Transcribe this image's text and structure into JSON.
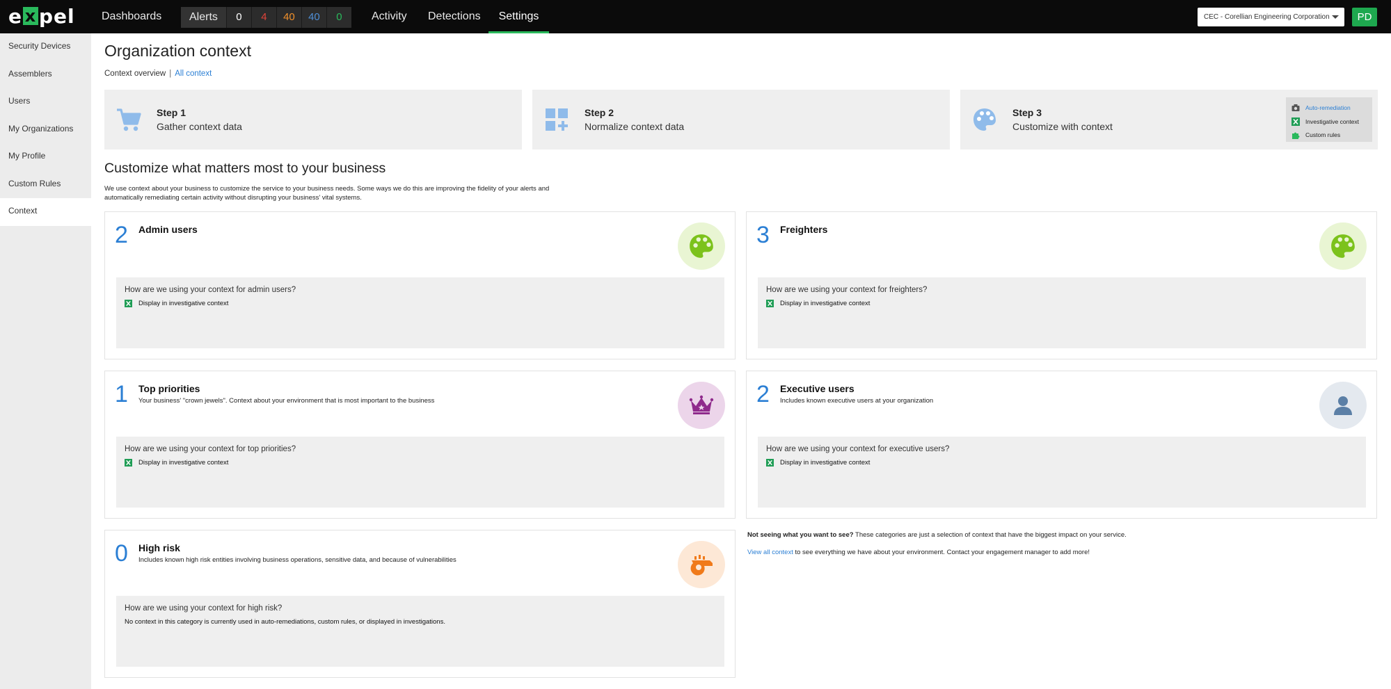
{
  "header": {
    "logo": {
      "before": "e",
      "x": "x",
      "after": "pel"
    },
    "nav": {
      "dashboards": "Dashboards",
      "alerts": "Alerts",
      "activity": "Activity",
      "detections": "Detections",
      "settings": "Settings"
    },
    "alert_counts": [
      {
        "value": "0",
        "color": "#ffffff"
      },
      {
        "value": "4",
        "color": "#e0443a"
      },
      {
        "value": "40",
        "color": "#f0902b"
      },
      {
        "value": "40",
        "color": "#4f8fd6"
      },
      {
        "value": "0",
        "color": "#2ab95c"
      }
    ],
    "org_select": "CEC - Corellian Engineering Corporation",
    "avatar": "PD"
  },
  "sidebar": {
    "items": [
      {
        "label": "Security Devices"
      },
      {
        "label": "Assemblers"
      },
      {
        "label": "Users"
      },
      {
        "label": "My Organizations"
      },
      {
        "label": "My Profile"
      },
      {
        "label": "Custom Rules"
      },
      {
        "label": "Context",
        "active": true
      }
    ]
  },
  "page": {
    "title": "Organization context",
    "breadcrumb": {
      "overview": "Context overview",
      "separator": "|",
      "all_context": "All context"
    }
  },
  "steps": [
    {
      "num": "Step 1",
      "desc": "Gather context data",
      "icon": "cart-icon"
    },
    {
      "num": "Step 2",
      "desc": "Normalize context data",
      "icon": "grid-plus-icon"
    },
    {
      "num": "Step 3",
      "desc": "Customize with context",
      "icon": "palette-icon"
    }
  ],
  "legend": {
    "auto_remediation": "Auto-remediation",
    "investigative_context": "Investigative context",
    "custom_rules": "Custom rules"
  },
  "section": {
    "title": "Customize what matters most to your business",
    "description": "We use context about your business to customize the service to your business needs. Some ways we do this are improving the fidelity of your alerts and automatically remediating certain activity without disrupting your business' vital systems."
  },
  "cards": {
    "admin": {
      "count": "2",
      "title": "Admin users",
      "subtitle": "",
      "question": "How are we using your context for admin users?",
      "usage": "Display in investigative context",
      "icon": "palette-icon"
    },
    "freighters": {
      "count": "3",
      "title": "Freighters",
      "subtitle": "",
      "question": "How are we using your context for freighters?",
      "usage": "Display in investigative context",
      "icon": "palette-icon"
    },
    "top_priorities": {
      "count": "1",
      "title": "Top priorities",
      "subtitle": "Your business' \"crown jewels\". Context about your environment that is most important to the business",
      "question": "How are we using your context for top priorities?",
      "usage": "Display in investigative context",
      "icon": "crown-icon"
    },
    "executive": {
      "count": "2",
      "title": "Executive users",
      "subtitle": "Includes known executive users at your organization",
      "question": "How are we using your context for executive users?",
      "usage": "Display in investigative context",
      "icon": "user-icon"
    },
    "high_risk": {
      "count": "0",
      "title": "High risk",
      "subtitle": "Includes known high risk entities involving business operations, sensitive data, and because of vulnerabilities",
      "question": "How are we using your context for high risk?",
      "usage": "No context in this category is currently used in auto-remediations, custom rules, or displayed in investigations.",
      "icon": "whistle-icon"
    }
  },
  "note": {
    "bold": "Not seeing what you want to see?",
    "text": " These categories are just a selection of context that have the biggest impact on your service.",
    "link": "View all context",
    "link_rest": " to see everything we have about your environment. Contact your engagement manager to add more!"
  },
  "colors": {
    "accent": "#2ab95c",
    "link": "#2b7fd4",
    "green_circle": "#e9f5d3",
    "purple_circle": "#ecd5ea",
    "grey_circle": "#e4e9ef",
    "orange_circle": "#fde8d6"
  }
}
